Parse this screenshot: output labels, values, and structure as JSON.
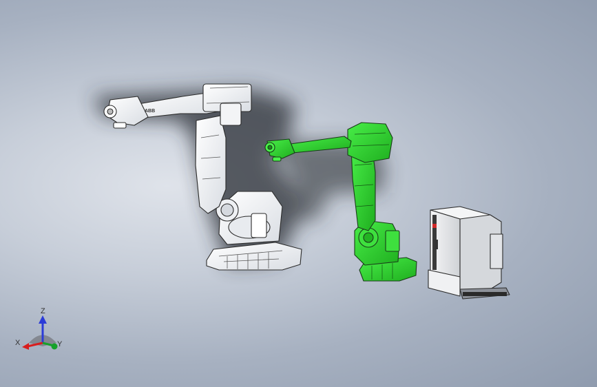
{
  "viewport": {
    "background_center": "#dfe3ea",
    "background_edge": "#8f9bae"
  },
  "models": [
    {
      "name": "white-robot",
      "color": "#f4f5f7",
      "logo_text": "ABB"
    },
    {
      "name": "green-robot",
      "color": "#2fd12f"
    },
    {
      "name": "controller-cabinet",
      "color": "#e6e7ea"
    }
  ],
  "triad": {
    "z_label": "Z",
    "x_label": "X",
    "y_label": "Y",
    "z_color": "#2b3bd8",
    "x_color": "#d81e1e",
    "y_color": "#16a12b"
  }
}
